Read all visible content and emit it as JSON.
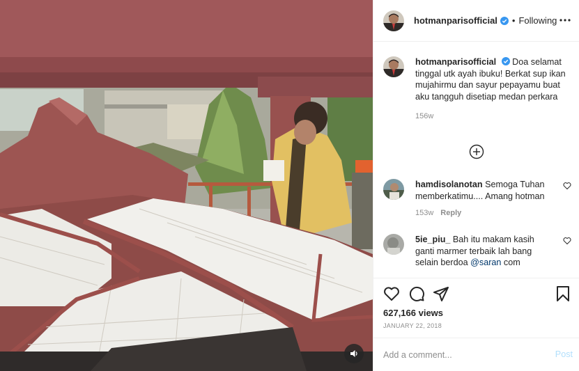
{
  "media": {
    "type": "video",
    "mute_icon": "speaker-icon"
  },
  "header": {
    "username": "hotmanparisofficial",
    "verified_icon": "verified-badge-icon",
    "separator": "•",
    "follow_state": "Following",
    "more_icon": "more-horizontal-icon"
  },
  "caption": {
    "username": "hotmanparisofficial",
    "text": "Doa selamat tinggal utk ayah ibuku! Berkat sup ikan mujahirmu dan sayur pepayamu buat aku tangguh disetiap medan perkara",
    "time": "156w"
  },
  "load_more_icon": "plus-circle-icon",
  "comments": [
    {
      "username": "hamdisolanotan",
      "text": "Semoga Tuhan memberkatimu.... Amang hotman",
      "time": "153w",
      "reply_label": "Reply"
    },
    {
      "username": "5ie_piu_",
      "text_before": "Bah itu makam kasih ganti marmer terbaik lah bang selain berdoa ",
      "mention": "@saran",
      "text_after": " com"
    }
  ],
  "actions": {
    "like_icon": "heart-icon",
    "comment_icon": "comment-icon",
    "share_icon": "paper-plane-icon",
    "save_icon": "bookmark-icon"
  },
  "stats": {
    "views": "627,166 views",
    "date": "JANUARY 22, 2018"
  },
  "add_comment": {
    "placeholder": "Add a comment...",
    "post_label": "Post"
  },
  "colors": {
    "link": "#00376b",
    "muted": "#8e8e8e",
    "verified": "#3897f0",
    "post_disabled": "#b2dffc"
  }
}
